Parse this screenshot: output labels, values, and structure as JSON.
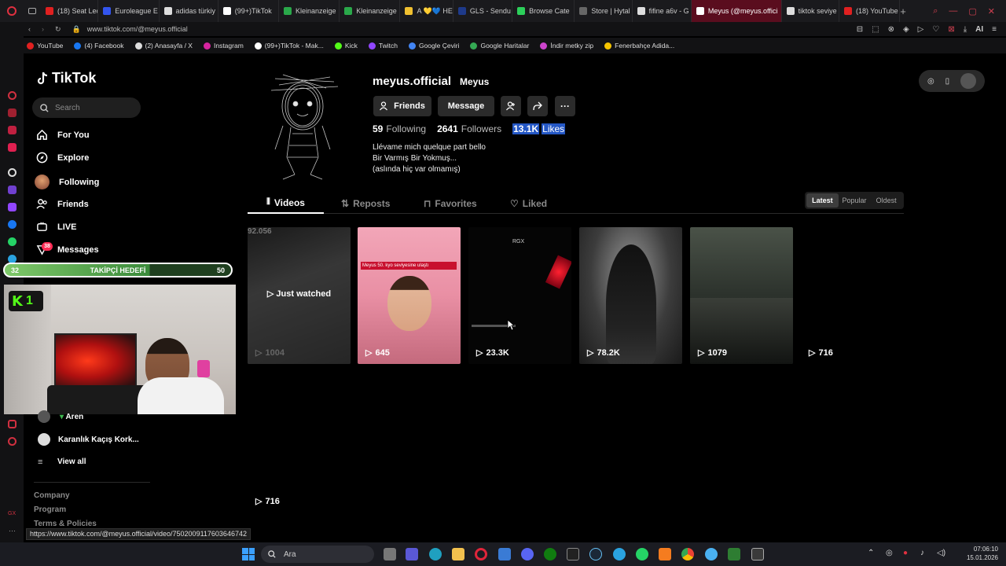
{
  "browser": {
    "tabs": [
      {
        "label": "(18) Seat Leo",
        "color": "#e02020"
      },
      {
        "label": "Euroleague E",
        "color": "#3355ee"
      },
      {
        "label": "adidas türkiy",
        "color": "#dddddd"
      },
      {
        "label": "(99+)TikTok",
        "color": "#ffffff"
      },
      {
        "label": "Kleinanzeige",
        "color": "#2aa84a"
      },
      {
        "label": "Kleinanzeige",
        "color": "#2aa84a"
      },
      {
        "label": "A 💛💙 HER",
        "color": "#f0c030"
      },
      {
        "label": "GLS - Sendu",
        "color": "#1e3a8a"
      },
      {
        "label": "Browse Cate",
        "color": "#2ccf5a"
      },
      {
        "label": "Store | Hytal",
        "color": "#666666"
      },
      {
        "label": "fifine a6v - G",
        "color": "#dddddd"
      },
      {
        "label": "Meyus (@meyus.offici",
        "color": "#ffffff",
        "active": true
      },
      {
        "label": "tiktok seviye",
        "color": "#dddddd"
      },
      {
        "label": "(18) YouTube",
        "color": "#e02020"
      }
    ],
    "url": "www.tiktok.com/@meyus.official",
    "ai_label": "AI",
    "bookmarks": [
      {
        "label": "YouTube",
        "color": "#e02020"
      },
      {
        "label": "(4) Facebook",
        "color": "#1877f2"
      },
      {
        "label": "(2) Anasayfa / X",
        "color": "#dddddd"
      },
      {
        "label": "Instagram",
        "color": "#d6249f"
      },
      {
        "label": "(99+)TikTok - Mak...",
        "color": "#ffffff"
      },
      {
        "label": "Kick",
        "color": "#53fc18"
      },
      {
        "label": "Twitch",
        "color": "#9146ff"
      },
      {
        "label": "Google Çeviri",
        "color": "#4285f4"
      },
      {
        "label": "Google Haritalar",
        "color": "#34a853"
      },
      {
        "label": "İndir metky zip",
        "color": "#cc44cc"
      },
      {
        "label": "Fenerbahçe Adida...",
        "color": "#f5c400"
      }
    ]
  },
  "sidebar": {
    "logo": "TikTok",
    "search_placeholder": "Search",
    "nav": [
      {
        "label": "For You",
        "icon": "home-icon"
      },
      {
        "label": "Explore",
        "icon": "compass-icon"
      },
      {
        "label": "Following",
        "icon": "avatar-icon"
      },
      {
        "label": "Friends",
        "icon": "friends-icon"
      },
      {
        "label": "LIVE",
        "icon": "live-icon"
      },
      {
        "label": "Messages",
        "icon": "messages-icon",
        "badge": "38"
      }
    ],
    "following_accounts": [
      {
        "label": "Aren"
      },
      {
        "label": "Karanlık Kaçış Kork..."
      }
    ],
    "view_all": "View all",
    "footer": [
      "Company",
      "Program",
      "Terms & Policies"
    ]
  },
  "stream_overlay": {
    "goal_label": "TAKİPÇİ HEDEFİ",
    "goal_current": "32",
    "goal_target": "50",
    "goal_progress": 0.64,
    "kick_count": "1"
  },
  "profile": {
    "username": "meyus.official",
    "display_name": "Meyus",
    "buttons": {
      "friends": "Friends",
      "message": "Message"
    },
    "stats": {
      "following_count": "59",
      "following_label": "Following",
      "followers_count": "2641",
      "followers_label": "Followers",
      "likes_count": "13.1K",
      "likes_label": "Likes"
    },
    "bio": [
      "Llévame mich quelque part bello",
      "Bir Varmış Bir Yokmuş...",
      "(aslında hiç var olmamış)"
    ],
    "tabs": [
      "Videos",
      "Reposts",
      "Favorites",
      "Liked"
    ],
    "sort": [
      "Latest",
      "Popular",
      "Oldest"
    ],
    "videos": [
      {
        "views": "1004",
        "overlay": "Just watched",
        "top_number": "92.056"
      },
      {
        "views": "645",
        "caption": "Meyus 50. kyo seviyesine ulaştı"
      },
      {
        "views": "23.3K",
        "tag": "RGX"
      },
      {
        "views": "78.2K"
      },
      {
        "views": "1079"
      },
      {
        "views": "716"
      },
      {
        "views": "716"
      }
    ]
  },
  "status_url": "https://www.tiktok.com/@meyus.official/video/7502009117603646742",
  "taskbar": {
    "search_label": "Ara",
    "time": "07:06:10",
    "date": "15.01.2026"
  }
}
